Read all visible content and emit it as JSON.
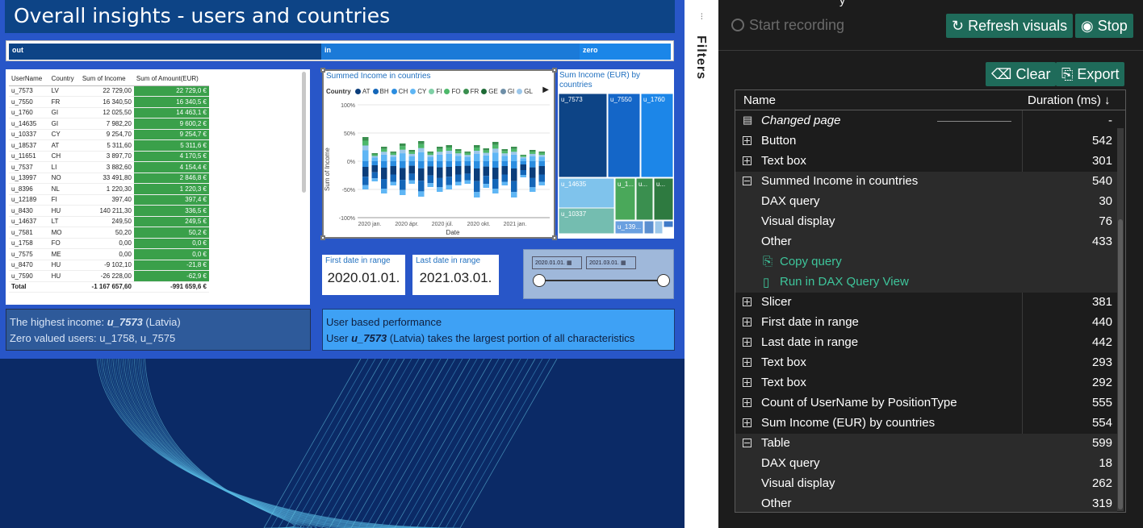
{
  "report": {
    "title": "Overall insights - users and countries",
    "buttons": [
      "out",
      "in",
      "zero"
    ],
    "table": {
      "headers": [
        "UserName",
        "Country",
        "Sum of Income",
        "Sum of Amount(EUR)"
      ],
      "rows": [
        [
          "u_7573",
          "LV",
          "22 729,00",
          "22 729,0 €"
        ],
        [
          "u_7550",
          "FR",
          "16 340,50",
          "16 340,5 €"
        ],
        [
          "u_1760",
          "GI",
          "12 025,50",
          "14 463,1 €"
        ],
        [
          "u_14635",
          "GI",
          "7 982,20",
          "9 600,2 €"
        ],
        [
          "u_10337",
          "CY",
          "9 254,70",
          "9 254,7 €"
        ],
        [
          "u_18537",
          "AT",
          "5 311,60",
          "5 311,6 €"
        ],
        [
          "u_11651",
          "CH",
          "3 897,70",
          "4 170,5 €"
        ],
        [
          "u_7537",
          "LI",
          "3 882,60",
          "4 154,4 €"
        ],
        [
          "u_13997",
          "NO",
          "33 491,80",
          "2 846,8 €"
        ],
        [
          "u_8396",
          "NL",
          "1 220,30",
          "1 220,3 €"
        ],
        [
          "u_12189",
          "FI",
          "397,40",
          "397,4 €"
        ],
        [
          "u_8430",
          "HU",
          "140 211,30",
          "336,5 €"
        ],
        [
          "u_14637",
          "LT",
          "249,50",
          "249,5 €"
        ],
        [
          "u_7581",
          "MO",
          "50,20",
          "50,2 €"
        ],
        [
          "u_1758",
          "FO",
          "0,00",
          "0,0 €"
        ],
        [
          "u_7575",
          "ME",
          "0,00",
          "0,0 €"
        ],
        [
          "u_8470",
          "HU",
          "-9 102,10",
          "-21,8 €"
        ],
        [
          "u_7590",
          "HU",
          "-26 228,00",
          "-62,9 €"
        ]
      ],
      "total": [
        "Total",
        "",
        "-1 167 657,60",
        "-991 659,6 €"
      ]
    },
    "summed_chart": {
      "title": "Summed Income in countries",
      "legend_title": "Country",
      "legend": [
        {
          "code": "AT",
          "color": "#0b3d7a"
        },
        {
          "code": "BH",
          "color": "#1466b8"
        },
        {
          "code": "CH",
          "color": "#2b8de0"
        },
        {
          "code": "CY",
          "color": "#5fb6f5"
        },
        {
          "code": "FI",
          "color": "#7fd0a6"
        },
        {
          "code": "FO",
          "color": "#4db86a"
        },
        {
          "code": "FR",
          "color": "#3a8f4f"
        },
        {
          "code": "GE",
          "color": "#1e6a35"
        },
        {
          "code": "GI",
          "color": "#6f8fa8"
        },
        {
          "code": "GL",
          "color": "#9cc7ea"
        }
      ],
      "y_axis_label": "Sum of Income",
      "x_axis_label": "Date",
      "y_ticks": [
        "100%",
        "50%",
        "0%",
        "-50%",
        "-100%"
      ],
      "x_ticks": [
        "2020 jan.",
        "2020 ápr.",
        "2020 júl.",
        "2020 okt.",
        "2021 jan."
      ]
    },
    "treemap": {
      "title": "Sum Income (EUR) by countries",
      "labels": [
        "u_7573",
        "u_7550",
        "u_1760",
        "u_14635",
        "u_10337",
        "u_1...",
        "u...",
        "u_139..."
      ]
    },
    "first_date": {
      "label": "First date in range",
      "value": "2020.01.01."
    },
    "last_date": {
      "label": "Last date in range",
      "value": "2021.03.01."
    },
    "slicer": {
      "from": "2020.01.01.",
      "to": "2021.03.01."
    },
    "note_left": {
      "line1_prefix": "The highest income: ",
      "line1_user": "u_7573",
      "line1_suffix": " (Latvia)",
      "line2": "Zero valued users: u_1758, u_7575"
    },
    "note_right": {
      "line1": "User based performance",
      "line2_prefix": "User ",
      "line2_user": "u_7573",
      "line2_suffix": " (Latvia) takes the largest portion of all characteristics"
    }
  },
  "filters": {
    "label": "Filters"
  },
  "analyzer": {
    "top_cut_text": "y",
    "start_recording": "Start recording",
    "refresh": "Refresh visuals",
    "stop": "Stop",
    "clear": "Clear",
    "export": "Export",
    "col_name": "Name",
    "col_duration": "Duration (ms)",
    "rows": [
      {
        "name": "Changed page",
        "duration": "-",
        "kind": "page",
        "highlight": false
      },
      {
        "name": "Button",
        "duration": "542",
        "kind": "plus",
        "highlight": false
      },
      {
        "name": "Text box",
        "duration": "301",
        "kind": "plus",
        "highlight": false
      },
      {
        "name": "Summed Income in countries",
        "duration": "540",
        "kind": "minus",
        "highlight": true
      },
      {
        "name": "DAX query",
        "duration": "30",
        "kind": "child",
        "highlight": true
      },
      {
        "name": "Visual display",
        "duration": "76",
        "kind": "child",
        "highlight": true
      },
      {
        "name": "Other",
        "duration": "433",
        "kind": "child",
        "highlight": true
      },
      {
        "name": "Copy query",
        "duration": "",
        "kind": "link-copy",
        "highlight": true
      },
      {
        "name": "Run in DAX Query View",
        "duration": "",
        "kind": "link-dax",
        "highlight": true
      },
      {
        "name": "Slicer",
        "duration": "381",
        "kind": "plus",
        "highlight": false
      },
      {
        "name": "First date in range",
        "duration": "440",
        "kind": "plus",
        "highlight": false
      },
      {
        "name": "Last date in range",
        "duration": "442",
        "kind": "plus",
        "highlight": false
      },
      {
        "name": "Text box",
        "duration": "293",
        "kind": "plus",
        "highlight": false
      },
      {
        "name": "Text box",
        "duration": "292",
        "kind": "plus",
        "highlight": false
      },
      {
        "name": "Count of UserName by PositionType",
        "duration": "555",
        "kind": "plus",
        "highlight": false
      },
      {
        "name": "Sum Income (EUR) by countries",
        "duration": "554",
        "kind": "plus",
        "highlight": false
      },
      {
        "name": "Table",
        "duration": "599",
        "kind": "minus",
        "highlight": true
      },
      {
        "name": "DAX query",
        "duration": "18",
        "kind": "child",
        "highlight": true
      },
      {
        "name": "Visual display",
        "duration": "262",
        "kind": "child",
        "highlight": true
      },
      {
        "name": "Other",
        "duration": "319",
        "kind": "child",
        "highlight": true
      }
    ]
  }
}
